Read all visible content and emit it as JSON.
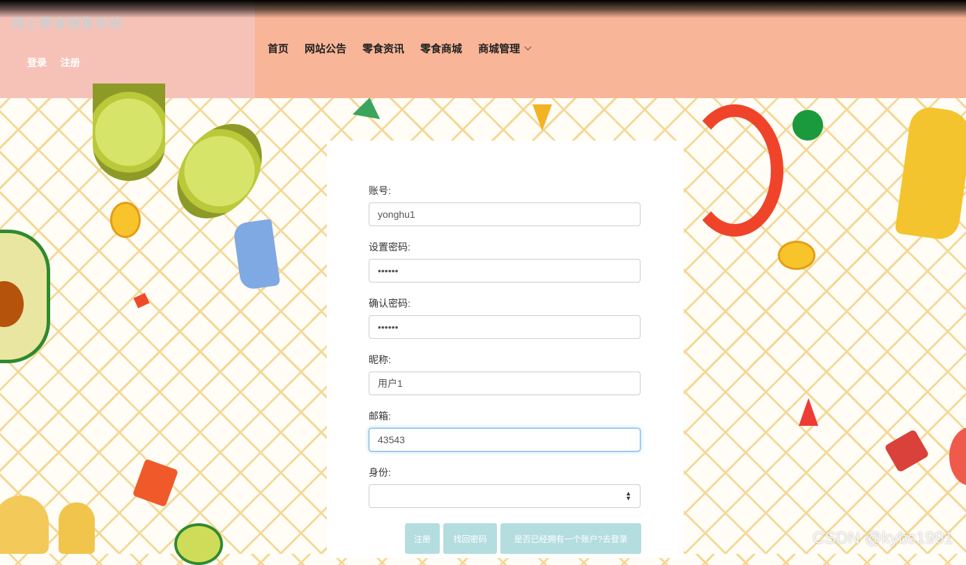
{
  "site": {
    "title": "网上零食销售系统"
  },
  "auth": {
    "login": "登录",
    "register": "注册"
  },
  "nav": {
    "items": [
      "首页",
      "网站公告",
      "零食资讯",
      "零食商城"
    ],
    "dropdown": "商城管理"
  },
  "form": {
    "account_label": "账号:",
    "account_value": "yonghu1",
    "password_label": "设置密码:",
    "password_value": "••••••",
    "confirm_label": "确认密码:",
    "confirm_value": "••••••",
    "nickname_label": "昵称:",
    "nickname_value": "用户1",
    "email_label": "邮箱:",
    "email_value": "43543",
    "identity_label": "身份:",
    "identity_value": ""
  },
  "buttons": {
    "register": "注册",
    "find_password": "找回密码",
    "go_login": "是否已经拥有一个账户?去登录"
  },
  "watermark": "CSDN @kybs1991",
  "colors": {
    "brand_panel": "#f6c2b8",
    "nav_panel": "#f9b597",
    "button": "#b4dde0",
    "focus": "#66afe9"
  }
}
